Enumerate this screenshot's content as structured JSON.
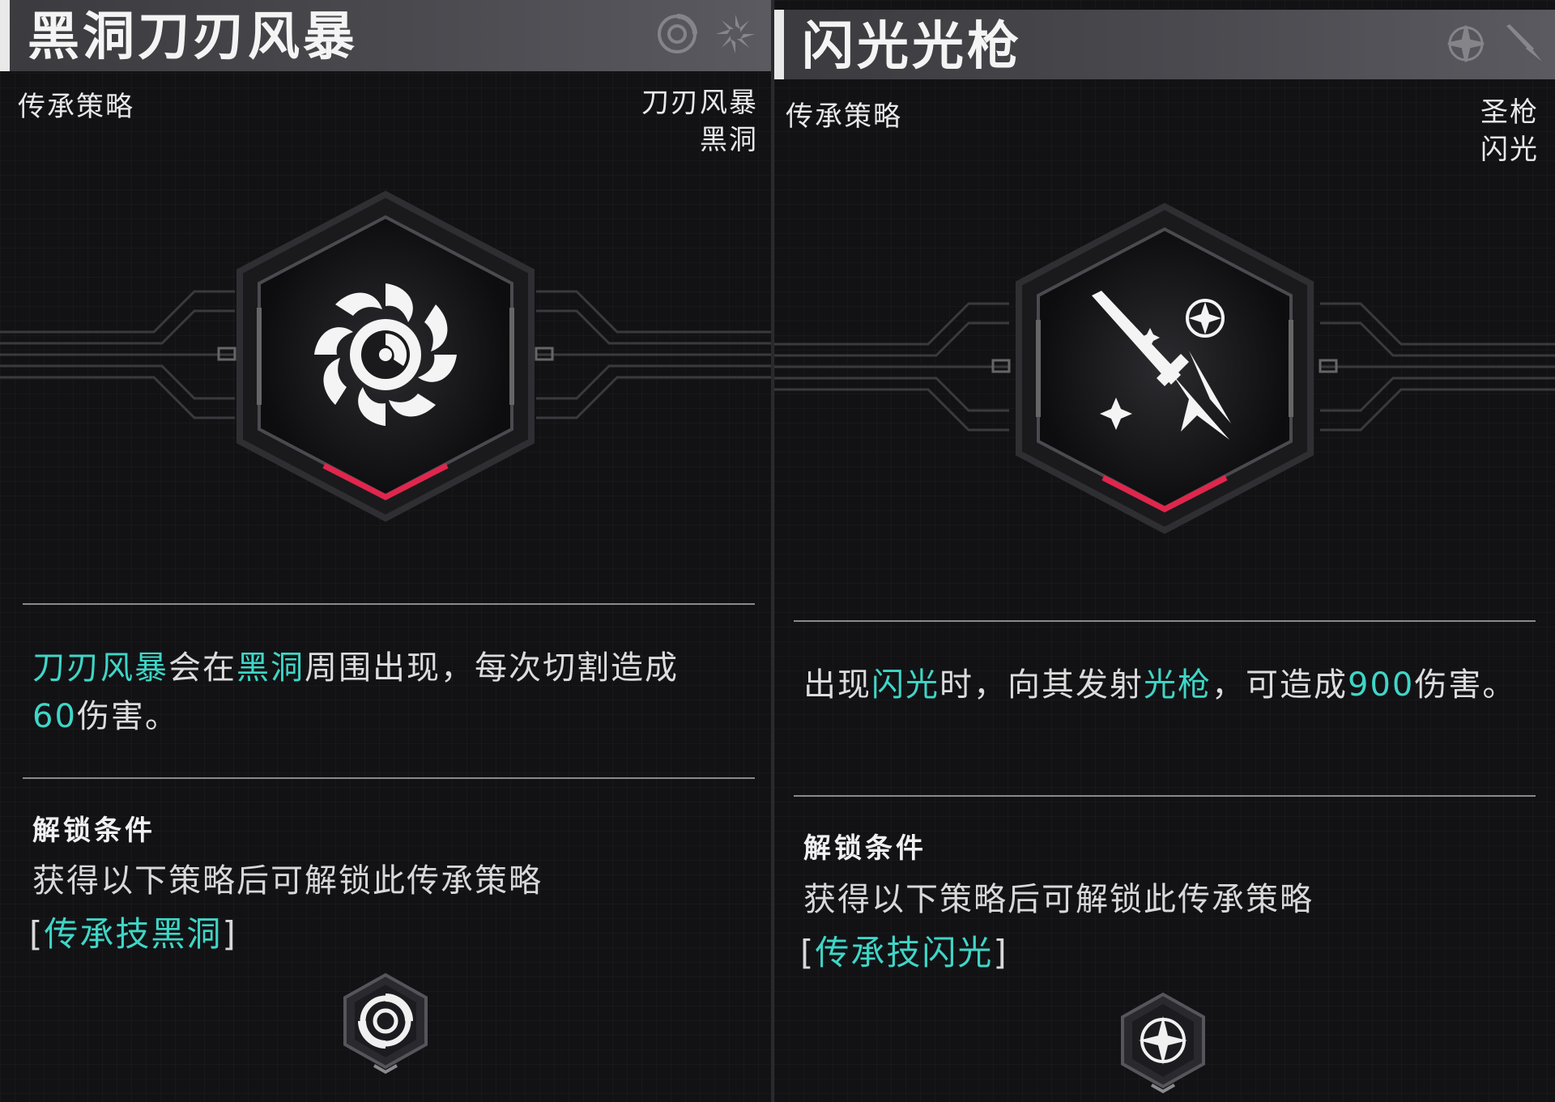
{
  "left": {
    "title": "黑洞刀刃风暴",
    "category": "传承策略",
    "tags": [
      "刀刃风暴",
      "黑洞"
    ],
    "description": {
      "hl1": "刀刃风暴",
      "t1": "会在",
      "hl2": "黑洞",
      "t2": "周围出现，每次切割造成",
      "hl3": "60",
      "t3": "伤害。"
    },
    "unlock": {
      "title": "解锁条件",
      "text": "获得以下策略后可解锁此传承策略",
      "link_open": "[",
      "link": "传承技黑洞",
      "link_close": "]"
    },
    "icon": "blade-vortex-icon"
  },
  "right": {
    "title": "闪光光枪",
    "category": "传承策略",
    "tags": [
      "圣枪",
      "闪光"
    ],
    "description": {
      "t0": "出现",
      "hl1": "闪光",
      "t1": "时，向其发射",
      "hl2": "光枪",
      "t2": "，可造成",
      "hl3": "900",
      "t3": "伤害。"
    },
    "unlock": {
      "title": "解锁条件",
      "text": "获得以下策略后可解锁此传承策略",
      "link_open": "[",
      "link": "传承技闪光",
      "link_close": "]"
    },
    "icon": "holy-spear-icon"
  },
  "colors": {
    "highlight": "#3fd6c6",
    "accent_red": "#e0264c",
    "header_bg": "#4a4a4f"
  }
}
